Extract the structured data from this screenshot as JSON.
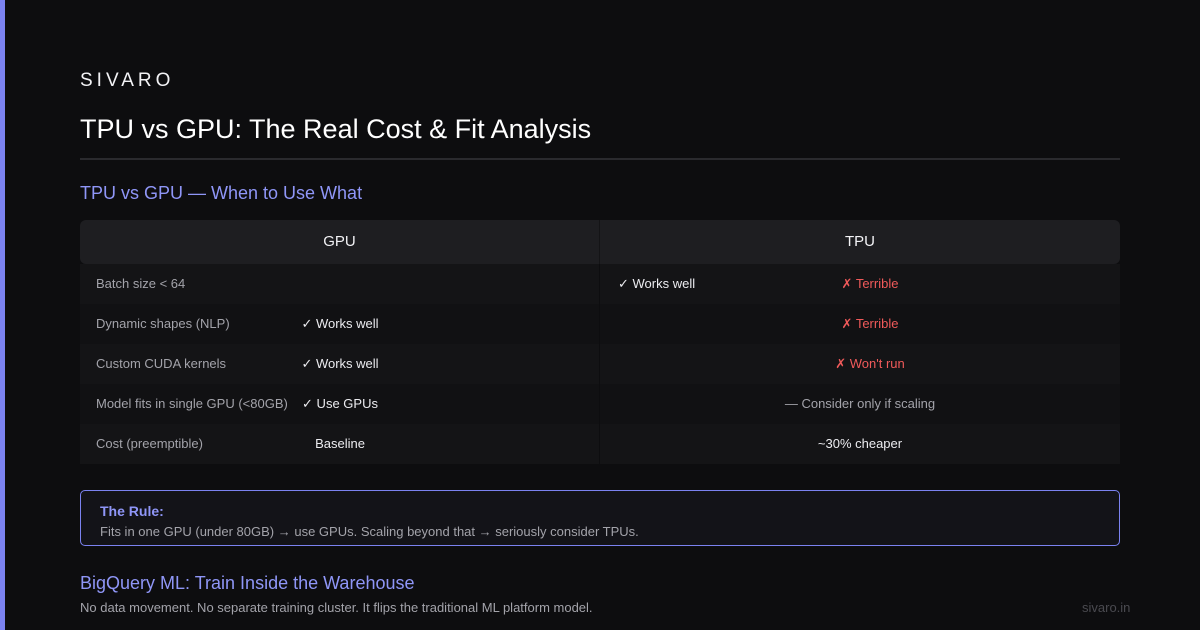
{
  "brand": "SIVARO",
  "page_title": "TPU vs GPU: The Real Cost & Fit Analysis",
  "section1_heading": "TPU vs GPU — When to Use What",
  "table": {
    "headers": [
      "GPU",
      "TPU"
    ],
    "rows": [
      {
        "label": "Batch size < 64",
        "gpu": "",
        "tpu_alt": "✓ Works well",
        "tpu": "✗ Terrible"
      },
      {
        "label": "Dynamic shapes (NLP)",
        "gpu": "✓ Works well",
        "tpu_alt": "",
        "tpu": "✗ Terrible"
      },
      {
        "label": "Custom CUDA kernels",
        "gpu": "✓ Works well",
        "tpu_alt": "",
        "tpu": "✗ Won't run"
      },
      {
        "label": "Model fits in single GPU (<80GB)",
        "gpu": "✓ Use GPUs",
        "tpu_alt": "",
        "tpu": "— Consider only if scaling"
      },
      {
        "label": "Cost (preemptible)",
        "gpu": "Baseline",
        "tpu_alt": "",
        "tpu": "~30% cheaper"
      }
    ]
  },
  "rule": {
    "title": "The Rule:",
    "text": "Fits in one GPU (under 80GB) → use GPUs. Scaling beyond that → seriously consider TPUs."
  },
  "section2_heading": "BigQuery ML: Train Inside the Warehouse",
  "section2_text": "No data movement. No separate training cluster. It flips the traditional ML platform model.",
  "footer_domain": "sivaro.in",
  "colors": {
    "accent": "#7b82f0",
    "heading": "#8f96f7",
    "bad": "#f05a5a",
    "background": "#0d0d0f"
  }
}
